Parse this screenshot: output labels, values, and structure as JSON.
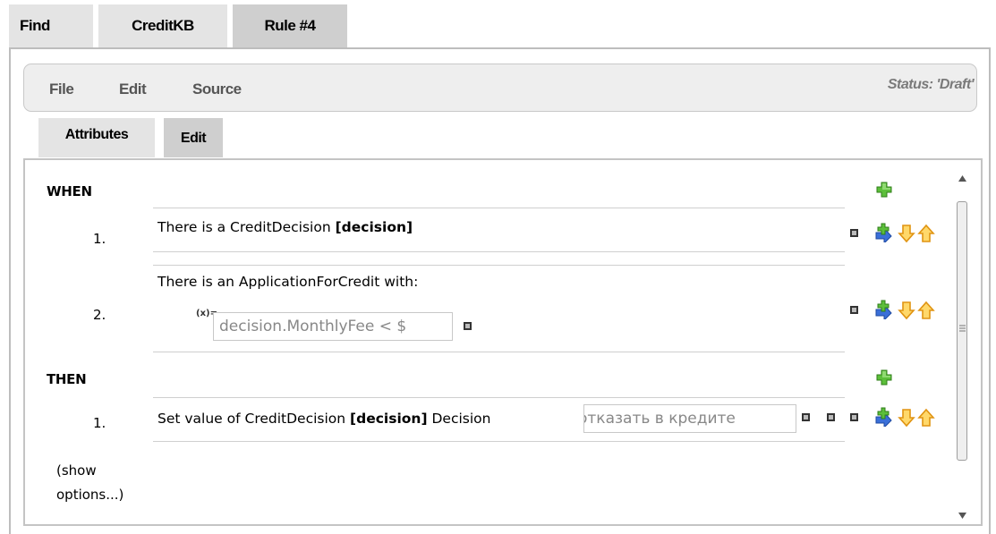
{
  "top_tabs": [
    "Find",
    "CreditKB",
    "Rule #4"
  ],
  "menu": {
    "file": "File",
    "edit": "Edit",
    "source": "Source",
    "status": "Status: 'Draft'"
  },
  "sub_tabs": [
    "Attributes",
    "Edit"
  ],
  "when": {
    "header": "WHEN",
    "conditions": [
      {
        "num": "1.",
        "text": "There is a CreditDecision ",
        "bold": "[decision]"
      },
      {
        "num": "2.",
        "text": "There is an ApplicationForCredit with:",
        "expr_label": "(x)=",
        "expr_value": "decision.MonthlyFee < $"
      }
    ]
  },
  "then": {
    "header": "THEN",
    "actions": [
      {
        "num": "1.",
        "text_a": "Set value of CreditDecision ",
        "bold": "[decision]",
        "text_b": " Decision",
        "field_value": "отказать в кредите"
      }
    ]
  },
  "show_options": "(show options...)",
  "icons": {
    "add": "green-plus-icon",
    "insert": "add-row-icon",
    "move_down": "arrow-down-icon",
    "move_up": "arrow-up-icon",
    "remove": "small-square-icon"
  },
  "colors": {
    "add_green": "#4caa2a",
    "arrow_orange": "#f0a820",
    "insert_blue": "#3a6fd8",
    "active_tab": "#cfcfcf",
    "inactive_tab": "#e4e4e4"
  }
}
